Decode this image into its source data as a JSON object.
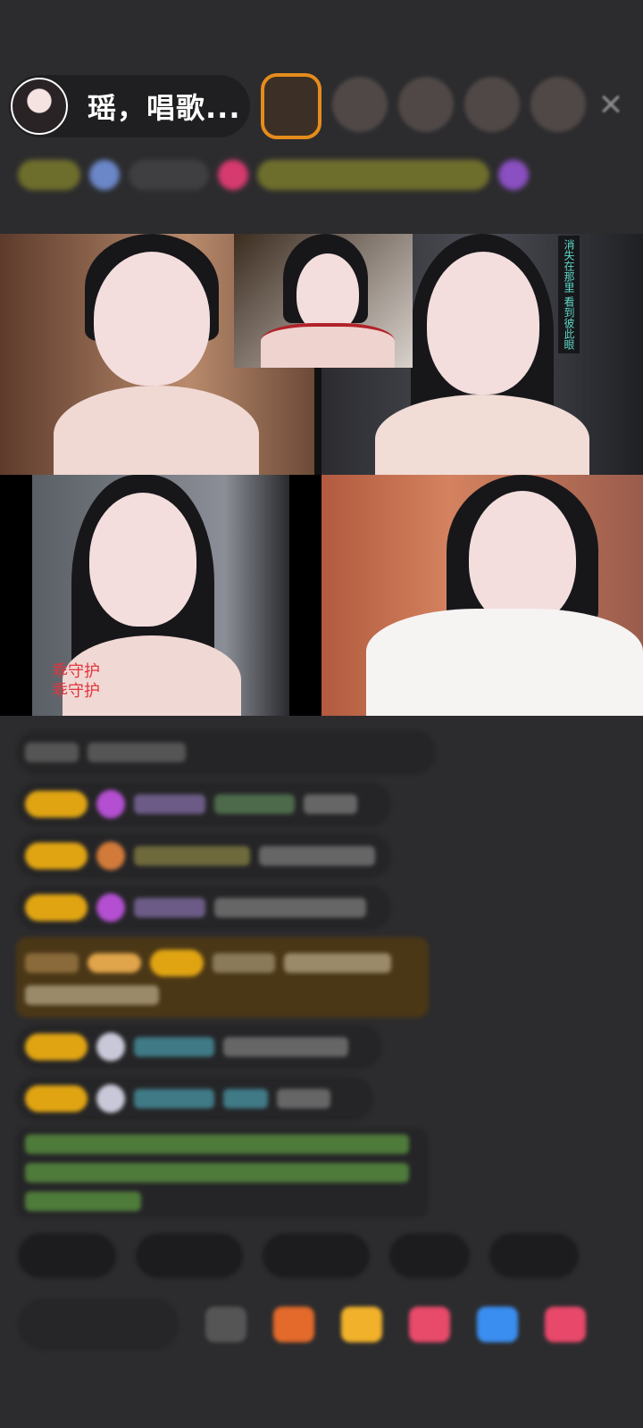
{
  "header": {
    "host_name": "瑶，唱歌..."
  },
  "colors": {
    "gift_badge": "#e0a413",
    "highlight_ring": "#e68c1c",
    "caption_red": "#e4343d",
    "caption_teal": "#5fd8c8"
  },
  "streams": {
    "tile_caption_left": "乖守护\n乖守护",
    "tile_caption_top_right": "消失在那里 看到彼此眼"
  }
}
